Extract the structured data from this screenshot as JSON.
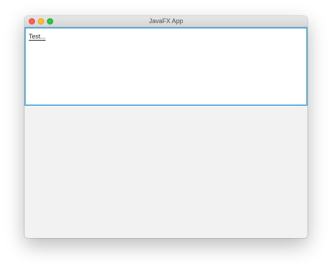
{
  "window": {
    "title": "JavaFX App"
  },
  "text_area": {
    "value": "Test..."
  },
  "colors": {
    "close": "#fc5f57",
    "minimize": "#fdbc2e",
    "zoom": "#28c840",
    "focus_border": "#3d9fd9"
  }
}
